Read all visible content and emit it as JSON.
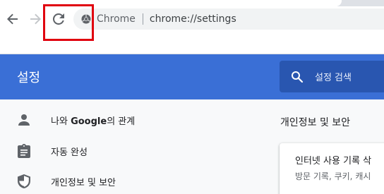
{
  "browser": {
    "site_chip_label": "Chrome",
    "url": "chrome://settings"
  },
  "settings": {
    "title": "설정",
    "search_placeholder": "설정 검색",
    "sidebar": {
      "items": [
        {
          "label_prefix": "나와 ",
          "label_bold": "Google",
          "label_suffix": "의 관계",
          "icon": "person-icon"
        },
        {
          "label": "자동 완성",
          "icon": "clipboard-icon"
        },
        {
          "label": "개인정보 및 보안",
          "icon": "shield-icon"
        }
      ]
    },
    "main": {
      "section_title": "개인정보 및 보안",
      "card": {
        "title": "인터넷 사용 기록 삭",
        "subtitle": "방문 기록, 쿠키, 캐시"
      }
    }
  },
  "colors": {
    "header_blue": "#3a6fd6",
    "search_box": "#2956b0",
    "highlight_red": "#e0000e"
  }
}
